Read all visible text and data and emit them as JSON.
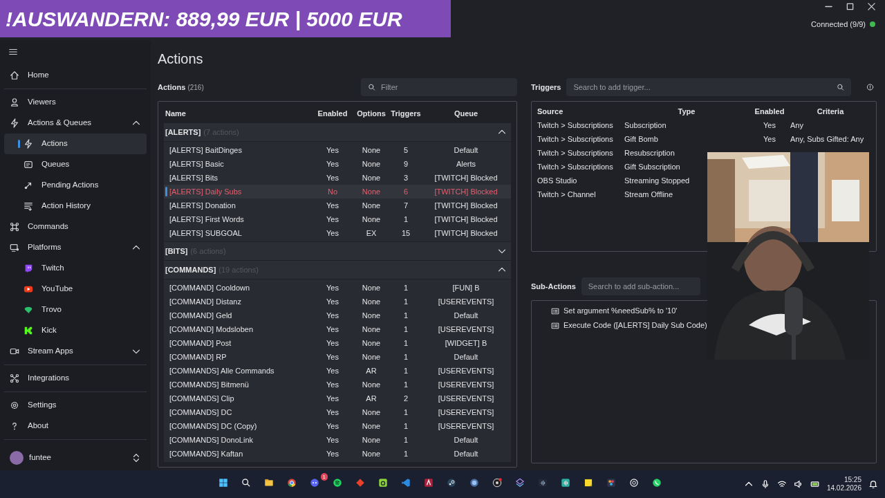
{
  "banner": {
    "text": "!AUSWANDERN: 889,99 EUR | 5000 EUR"
  },
  "connection": {
    "label": "Connected (9/9)",
    "color": "#3fb950"
  },
  "sidebar": {
    "sections": [
      [
        {
          "label": "Home",
          "selected": false
        }
      ],
      [
        {
          "label": "Viewers",
          "selected": false
        },
        {
          "label": "Actions & Queues",
          "selected": false,
          "expanded": true,
          "children": [
            {
              "label": "Actions",
              "selected": true
            },
            {
              "label": "Queues",
              "selected": false
            },
            {
              "label": "Pending Actions",
              "selected": false
            },
            {
              "label": "Action History",
              "selected": false
            }
          ]
        },
        {
          "label": "Commands",
          "selected": false
        },
        {
          "label": "Platforms",
          "selected": false,
          "expanded": true,
          "children": [
            {
              "label": "Twitch",
              "selected": false
            },
            {
              "label": "YouTube",
              "selected": false
            },
            {
              "label": "Trovo",
              "selected": false
            },
            {
              "label": "Kick",
              "selected": false
            }
          ]
        },
        {
          "label": "Stream Apps",
          "selected": false,
          "expanded": false
        }
      ],
      [
        {
          "label": "Integrations",
          "selected": false
        }
      ],
      [
        {
          "label": "Settings",
          "selected": false
        },
        {
          "label": "About",
          "selected": false
        }
      ]
    ],
    "user": {
      "name": "funtee"
    }
  },
  "page_title": "Actions",
  "actions": {
    "title": "Actions",
    "count": "(216)",
    "filter_placeholder": "Filter",
    "columns": [
      "Name",
      "Enabled",
      "Options",
      "Triggers",
      "Queue"
    ],
    "groups": [
      {
        "name": "[ALERTS]",
        "count": "(7 actions)",
        "expanded": true,
        "rows": [
          {
            "name": "[ALERTS] BaitDinges",
            "enabled": "Yes",
            "options": "None",
            "triggers": "5",
            "queue": "Default",
            "disabled": false,
            "selected": false
          },
          {
            "name": "[ALERTS] Basic",
            "enabled": "Yes",
            "options": "None",
            "triggers": "9",
            "queue": "Alerts",
            "disabled": false,
            "selected": false
          },
          {
            "name": "[ALERTS] Bits",
            "enabled": "Yes",
            "options": "None",
            "triggers": "3",
            "queue": "[TWITCH] Blocked",
            "disabled": false,
            "selected": false
          },
          {
            "name": "[ALERTS] Daily Subs",
            "enabled": "No",
            "options": "None",
            "triggers": "6",
            "queue": "[TWITCH] Blocked",
            "disabled": true,
            "selected": true
          },
          {
            "name": "[ALERTS] Donation",
            "enabled": "Yes",
            "options": "None",
            "triggers": "7",
            "queue": "[TWITCH] Blocked",
            "disabled": false,
            "selected": false
          },
          {
            "name": "[ALERTS] First Words",
            "enabled": "Yes",
            "options": "None",
            "triggers": "1",
            "queue": "[TWITCH] Blocked",
            "disabled": false,
            "selected": false
          },
          {
            "name": "[ALERTS] SUBGOAL",
            "enabled": "Yes",
            "options": "EX",
            "triggers": "15",
            "queue": "[TWITCH] Blocked",
            "disabled": false,
            "selected": false
          }
        ]
      },
      {
        "name": "[BITS]",
        "count": "(6 actions)",
        "expanded": false
      },
      {
        "name": "[COMMANDS]",
        "count": "(19 actions)",
        "expanded": true,
        "rows": [
          {
            "name": "[COMMAND] Cooldown",
            "enabled": "Yes",
            "options": "None",
            "triggers": "1",
            "queue": "[FUN] B",
            "disabled": false,
            "selected": false
          },
          {
            "name": "[COMMAND] Distanz",
            "enabled": "Yes",
            "options": "None",
            "triggers": "1",
            "queue": "[USEREVENTS]",
            "disabled": false,
            "selected": false
          },
          {
            "name": "[COMMAND] Geld",
            "enabled": "Yes",
            "options": "None",
            "triggers": "1",
            "queue": "Default",
            "disabled": false,
            "selected": false
          },
          {
            "name": "[COMMAND] Modsloben",
            "enabled": "Yes",
            "options": "None",
            "triggers": "1",
            "queue": "[USEREVENTS]",
            "disabled": false,
            "selected": false
          },
          {
            "name": "[COMMAND] Post",
            "enabled": "Yes",
            "options": "None",
            "triggers": "1",
            "queue": "[WIDGET] B",
            "disabled": false,
            "selected": false
          },
          {
            "name": "[COMMAND] RP",
            "enabled": "Yes",
            "options": "None",
            "triggers": "1",
            "queue": "Default",
            "disabled": false,
            "selected": false
          },
          {
            "name": "[COMMANDS] Alle Commands",
            "enabled": "Yes",
            "options": "AR",
            "triggers": "1",
            "queue": "[USEREVENTS]",
            "disabled": false,
            "selected": false
          },
          {
            "name": "[COMMANDS] Bitmenü",
            "enabled": "Yes",
            "options": "None",
            "triggers": "1",
            "queue": "[USEREVENTS]",
            "disabled": false,
            "selected": false
          },
          {
            "name": "[COMMANDS] Clip",
            "enabled": "Yes",
            "options": "AR",
            "triggers": "2",
            "queue": "[USEREVENTS]",
            "disabled": false,
            "selected": false
          },
          {
            "name": "[COMMANDS] DC",
            "enabled": "Yes",
            "options": "None",
            "triggers": "1",
            "queue": "[USEREVENTS]",
            "disabled": false,
            "selected": false
          },
          {
            "name": "[COMMANDS] DC (Copy)",
            "enabled": "Yes",
            "options": "None",
            "triggers": "1",
            "queue": "[USEREVENTS]",
            "disabled": false,
            "selected": false
          },
          {
            "name": "[COMMANDS] DonoLink",
            "enabled": "Yes",
            "options": "None",
            "triggers": "1",
            "queue": "Default",
            "disabled": false,
            "selected": false
          },
          {
            "name": "[COMMANDS] Kaftan",
            "enabled": "Yes",
            "options": "None",
            "triggers": "1",
            "queue": "Default",
            "disabled": false,
            "selected": false
          }
        ]
      }
    ]
  },
  "triggers": {
    "title": "Triggers",
    "search_placeholder": "Search to add trigger...",
    "columns": [
      "Source",
      "Type",
      "Enabled",
      "Criteria"
    ],
    "rows": [
      {
        "source": "Twitch > Subscriptions",
        "type": "Subscription",
        "enabled": "Yes",
        "criteria": "Any"
      },
      {
        "source": "Twitch > Subscriptions",
        "type": "Gift Bomb",
        "enabled": "Yes",
        "criteria": "Any, Subs Gifted: Any"
      },
      {
        "source": "Twitch > Subscriptions",
        "type": "Resubscription"
      },
      {
        "source": "Twitch > Subscriptions",
        "type": "Gift Subscription"
      },
      {
        "source": "OBS Studio",
        "type": "Streaming Stopped"
      },
      {
        "source": "Twitch > Channel",
        "type": "Stream Offline"
      }
    ]
  },
  "sub_actions": {
    "title": "Sub-Actions",
    "search_placeholder": "Search to add sub-action...",
    "items": [
      "Set argument %needSub% to '10'",
      "Execute Code ([ALERTS] Daily Sub Code)"
    ]
  },
  "taskbar": {
    "badge": "1",
    "time": "15:25",
    "date": "14.02.2026"
  }
}
